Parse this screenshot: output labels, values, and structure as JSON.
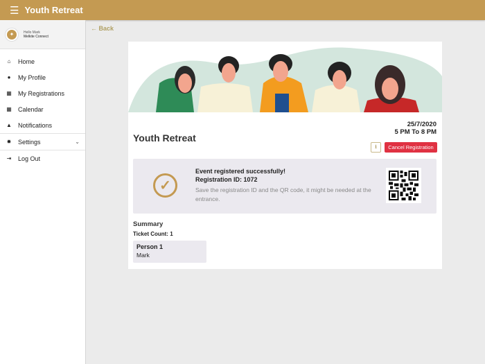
{
  "header": {
    "title": "Youth Retreat",
    "menu_icon": "hamburger-icon"
  },
  "sidebar": {
    "greeting": "Hello Mark",
    "org": "Melkite Connect",
    "items": [
      {
        "label": "Home",
        "icon": "home-icon"
      },
      {
        "label": "My Profile",
        "icon": "user-icon"
      },
      {
        "label": "My Registrations",
        "icon": "calendar-icon"
      },
      {
        "label": "Calendar",
        "icon": "calendar-icon"
      },
      {
        "label": "Notifications",
        "icon": "bell-icon"
      },
      {
        "label": "Settings",
        "icon": "gear-icon"
      },
      {
        "label": "Log Out",
        "icon": "logout-icon"
      }
    ]
  },
  "main": {
    "back": "Back",
    "event_title": "Youth Retreat",
    "date": "25/7/2020",
    "time": "5 PM To 8 PM",
    "cancel_label": "Cancel Registration",
    "success_title": "Event registered successfully!",
    "registration_id": "Registration ID: 1072",
    "note": "Save the registration ID and the QR code, it might be needed at the entrance.",
    "summary": "Summary",
    "ticket_count": "Ticket Count: 1",
    "persons": [
      {
        "label": "Person 1",
        "name": "Mark"
      }
    ]
  },
  "colors": {
    "brand": "#c49a52",
    "danger": "#e03142"
  }
}
